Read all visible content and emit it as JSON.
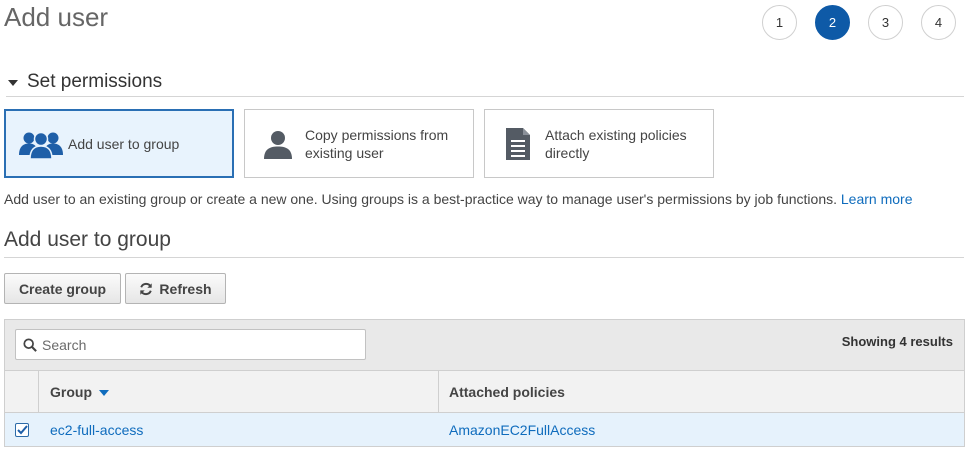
{
  "page": {
    "title": "Add user"
  },
  "steps": [
    {
      "label": "1",
      "active": false
    },
    {
      "label": "2",
      "active": true
    },
    {
      "label": "3",
      "active": false
    },
    {
      "label": "4",
      "active": false
    }
  ],
  "permissions": {
    "heading": "Set permissions",
    "options": [
      {
        "label": "Add user to group",
        "icon": "group-icon",
        "selected": true
      },
      {
        "label": "Copy permissions from existing user",
        "icon": "user-icon",
        "selected": false
      },
      {
        "label": "Attach existing policies directly",
        "icon": "document-icon",
        "selected": false
      }
    ],
    "description": "Add user to an existing group or create a new one. Using groups is a best-practice way to manage user's permissions by job functions.",
    "learn_more": "Learn more"
  },
  "group_section": {
    "title": "Add user to group",
    "create_button": "Create group",
    "refresh_button": "Refresh"
  },
  "table": {
    "search_placeholder": "Search",
    "results_text": "Showing 4 results",
    "columns": {
      "group": "Group",
      "policies": "Attached policies"
    },
    "rows": [
      {
        "group": "ec2-full-access",
        "policies": "AmazonEC2FullAccess",
        "checked": true
      }
    ]
  },
  "colors": {
    "accent": "#0e5aa7",
    "link": "#0f6cbd",
    "selected_bg": "#e8f3fd"
  }
}
